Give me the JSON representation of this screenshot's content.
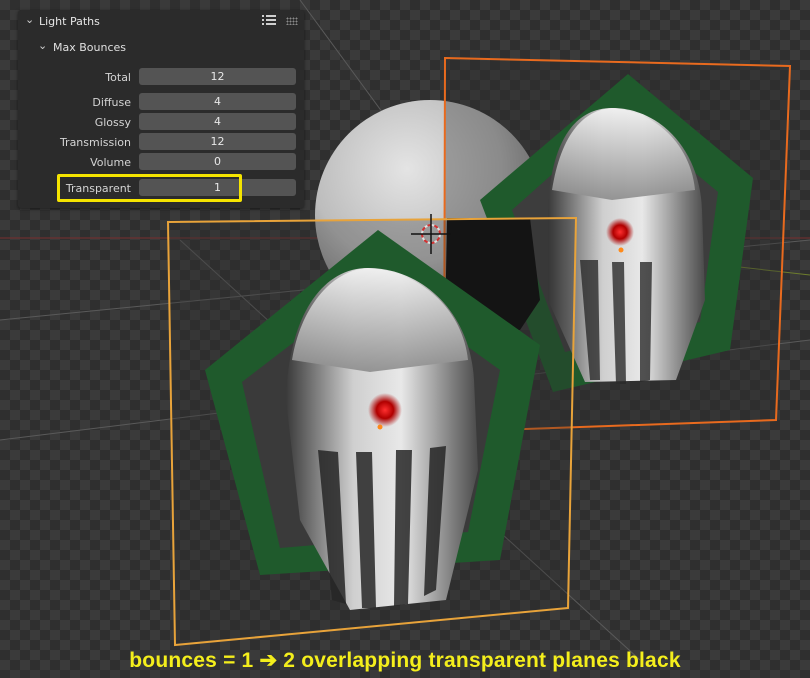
{
  "panel": {
    "title": "Light Paths",
    "subtitle": "Max Bounces",
    "rows": [
      {
        "label": "Total",
        "value": "12"
      },
      {
        "label": "Diffuse",
        "value": "4"
      },
      {
        "label": "Glossy",
        "value": "4"
      },
      {
        "label": "Transmission",
        "value": "12"
      },
      {
        "label": "Volume",
        "value": "0"
      },
      {
        "label": "Transparent",
        "value": "1"
      }
    ]
  },
  "caption": "bounces = 1  ➔  2 overlapping transparent planes black",
  "colors": {
    "highlight": "#f5e400",
    "selection_active": "#e8a33a",
    "selection": "#e86a1e",
    "badge_green": "#1f5a2c",
    "caption": "#f4ee1c"
  },
  "icons": [
    "chevron-down-icon",
    "list-icon",
    "drag-grip-icon",
    "3d-cursor-icon"
  ]
}
